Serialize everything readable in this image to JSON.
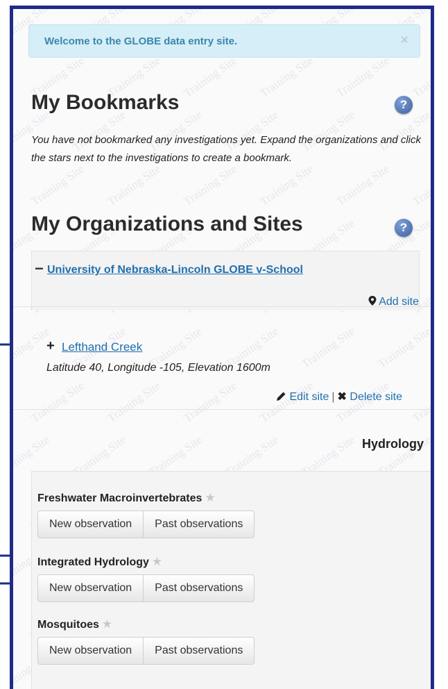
{
  "alert": {
    "message": "Welcome to the GLOBE data entry site.",
    "close": "×"
  },
  "bookmarks": {
    "title": "My Bookmarks",
    "help": "?",
    "empty_text": "You have not bookmarked any investigations yet. Expand the organizations and click the stars next to the investigations to create a bookmark."
  },
  "organizations": {
    "title": "My Organizations and Sites",
    "help": "?",
    "org": {
      "toggle": "−",
      "name": "University of Nebraska-Lincoln GLOBE v-School",
      "add_site": "Add site"
    }
  },
  "site": {
    "toggle": "+",
    "name": "Lefthand Creek",
    "info": "Latitude 40, Longitude -105, Elevation 1600m",
    "edit": "Edit site",
    "separator": "|",
    "delete": "Delete site"
  },
  "protocol_group": "Hydrology",
  "investigations": [
    {
      "name": "Freshwater Macroinvertebrates",
      "new_label": "New observation",
      "past_label": "Past observations"
    },
    {
      "name": "Integrated Hydrology",
      "new_label": "New observation",
      "past_label": "Past observations"
    },
    {
      "name": "Mosquitoes",
      "new_label": "New observation",
      "past_label": "Past observations"
    }
  ],
  "watermark": "Training Site",
  "colors": {
    "border": "#1f2a8a",
    "link": "#1f6fb0",
    "alert_bg": "#d6eef7",
    "alert_text": "#3a87ad",
    "arrow": "#1f2a8a"
  }
}
